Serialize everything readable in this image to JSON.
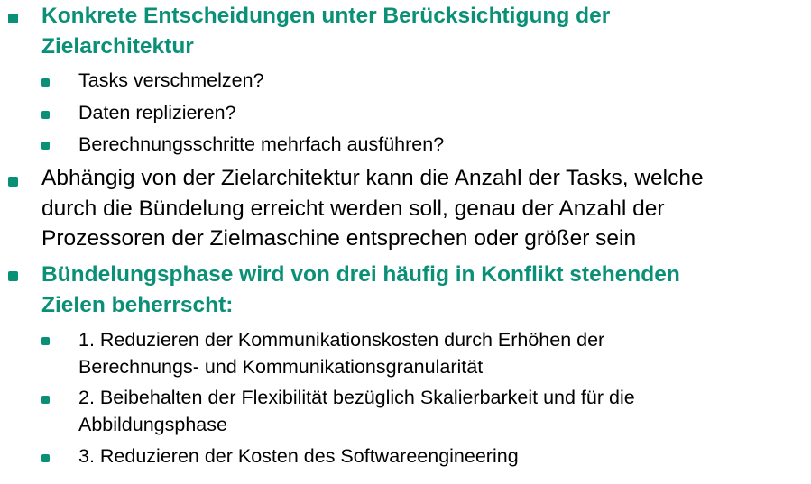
{
  "colors": {
    "accent": "#0b9078",
    "text": "#000000"
  },
  "slide": {
    "items": [
      {
        "lines": [
          "Konkrete Entscheidungen unter Berücksichtigung der",
          "Zielarchitektur"
        ],
        "subitems": [
          {
            "lines": [
              "Tasks verschmelzen?"
            ]
          },
          {
            "lines": [
              "Daten replizieren?"
            ]
          },
          {
            "lines": [
              "Berechnungsschritte mehrfach ausführen?"
            ]
          }
        ]
      },
      {
        "lines": [
          "Abhängig von der Zielarchitektur kann die Anzahl der Tasks, welche",
          "durch die Bündelung erreicht werden soll, genau der Anzahl der",
          "Prozessoren der Zielmaschine entsprechen oder größer sein"
        ]
      },
      {
        "lines": [
          "Bündelungsphase wird von drei häufig in Konflikt stehenden",
          "Zielen beherrscht:"
        ],
        "subitems": [
          {
            "lines": [
              "1. Reduzieren der Kommunikationskosten durch Erhöhen der",
              "Berechnungs- und Kommunikationsgranularität"
            ]
          },
          {
            "lines": [
              "2. Beibehalten der Flexibilität bezüglich Skalierbarkeit und für die",
              "Abbildungsphase"
            ]
          },
          {
            "lines": [
              "3. Reduzieren der Kosten des Softwareengineering"
            ]
          }
        ]
      }
    ]
  }
}
